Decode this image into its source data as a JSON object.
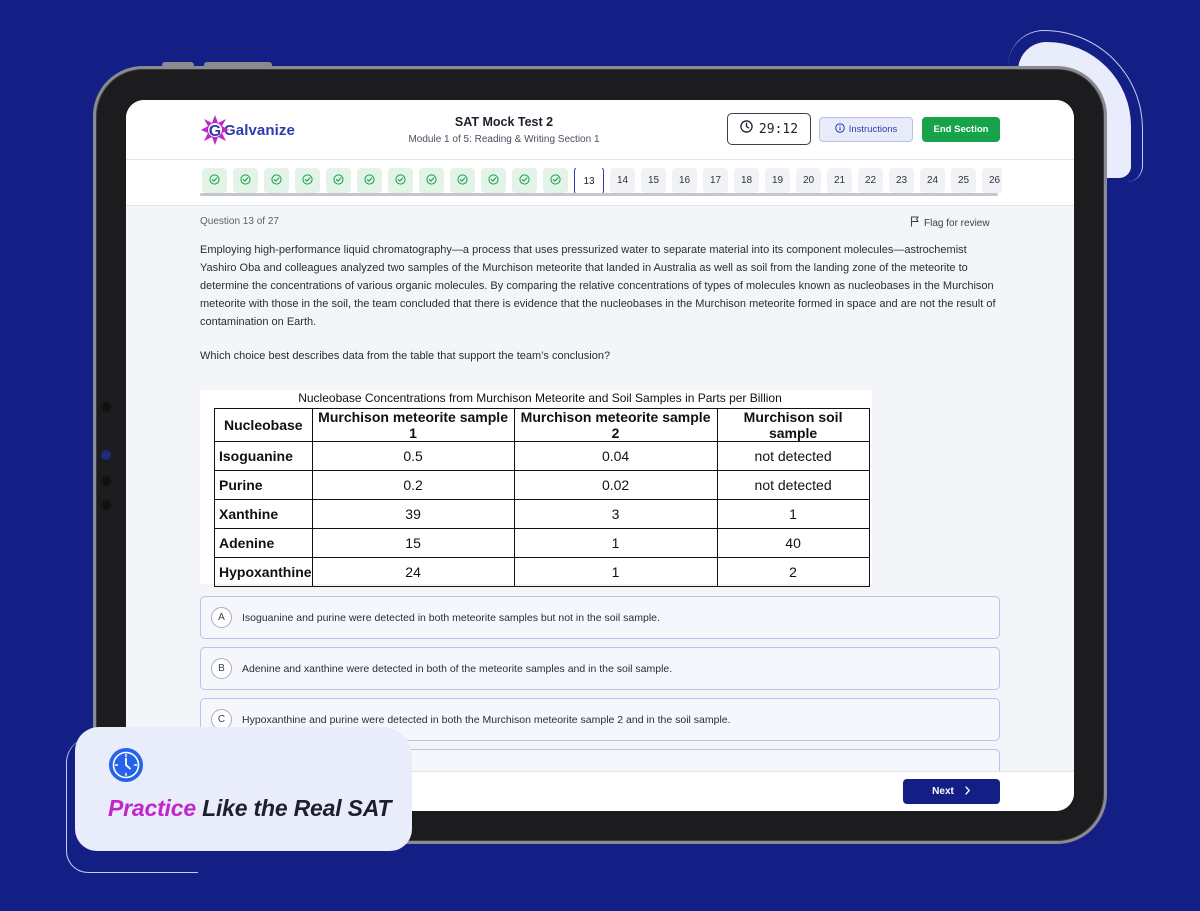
{
  "app": {
    "logo_text": "Galvanize"
  },
  "header": {
    "title": "SAT Mock Test 2",
    "subtitle": "Module 1 of 5: Reading & Writing Section 1",
    "timer": "29:12",
    "instructions_label": "Instructions",
    "end_section_label": "End Section"
  },
  "question_nav": {
    "completed_count": 12,
    "current": "13",
    "remaining": [
      "14",
      "15",
      "16",
      "17",
      "18",
      "19",
      "20",
      "21",
      "22",
      "23",
      "24",
      "25",
      "26"
    ]
  },
  "question": {
    "counter": "Question 13 of 27",
    "flag_label": "Flag for review",
    "passage": "Employing high-performance liquid chromatography—a process that uses pressurized water to separate material into its component molecules—astrochemist Yashiro Oba and colleagues analyzed two samples of the Murchison meteorite that landed in Australia as well as soil from the landing zone of the meteorite to determine the concentrations of various organic molecules. By comparing the relative concentrations of types of molecules known as nucleobases in the Murchison meteorite with those in the soil, the team concluded that there is evidence that the nucleobases in the Murchison meteorite formed in space and are not the result of contamination on Earth.",
    "prompt": "Which choice best describes data from the table that support the team’s conclusion?"
  },
  "table": {
    "title": "Nucleobase Concentrations from Murchison Meteorite and Soil Samples in Parts per Billion",
    "headers": [
      "Nucleobase",
      "Murchison meteorite sample 1",
      "Murchison meteorite sample 2",
      "Murchison soil sample"
    ],
    "rows": [
      [
        "Isoguanine",
        "0.5",
        "0.04",
        "not detected"
      ],
      [
        "Purine",
        "0.2",
        "0.02",
        "not detected"
      ],
      [
        "Xanthine",
        "39",
        "3",
        "1"
      ],
      [
        "Adenine",
        "15",
        "1",
        "40"
      ],
      [
        "Hypoxanthine",
        "24",
        "1",
        "2"
      ]
    ]
  },
  "choices": [
    {
      "letter": "A",
      "text": "Isoguanine and purine were detected in both meteorite samples but not in the soil sample."
    },
    {
      "letter": "B",
      "text": "Adenine and xanthine were detected in both of the meteorite samples and in the soil sample."
    },
    {
      "letter": "C",
      "text": "Hypoxanthine and purine were detected in both the Murchison meteorite sample 2 and in the soil sample."
    }
  ],
  "footer": {
    "next_label": "Next"
  },
  "promo": {
    "highlight": "Practice",
    "rest": " Like the Real SAT"
  },
  "colors": {
    "background": "#141f86",
    "accent": "#2f3ba8",
    "success": "#16a34a",
    "highlight": "#c026c9"
  }
}
